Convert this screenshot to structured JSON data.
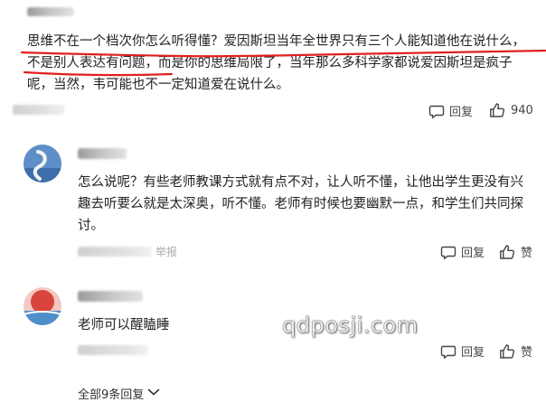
{
  "comment_main": {
    "text": "思维不在一个档次你怎么听得懂？爱因斯坦当年全世界只有三个人能知道他在说什么，不是别人表达有问题，而是你的思维局限了，当年那么多科学家都说爱因斯坦是疯子呢，当然，韦可能也不一定知道爱在说什么。",
    "reply_label": "回复",
    "like_count": "940"
  },
  "reply_1": {
    "text": "怎么说呢？有些老师教课方式就有点不对，让人听不懂，让他出学生更没有兴趣去听要么就是太深奥，听不懂。老师有时候也要幽默一点，和学生们共同探讨。",
    "report_label": "举报",
    "reply_label": "回复",
    "like_label": "赞"
  },
  "reply_2": {
    "text": "老师可以醒瞌睡",
    "reply_label": "回复",
    "like_label": "赞"
  },
  "more_replies_label": "全部9条回复",
  "watermark": "qdposji.com",
  "colors": {
    "annotation_red": "#e0201f",
    "text": "#222222",
    "meta": "#aaaaaa",
    "icon": "#444444"
  },
  "icons": [
    "comment-icon",
    "thumbs-up-icon",
    "chevron-down-icon"
  ]
}
